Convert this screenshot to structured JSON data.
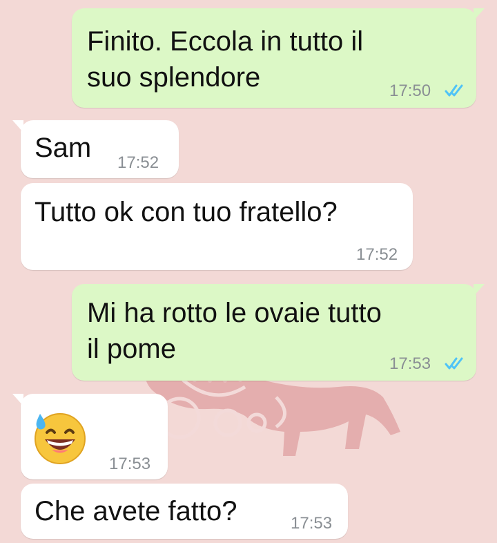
{
  "theme": {
    "outgoing_bubble": "#dcf8c6",
    "incoming_bubble": "#ffffff",
    "wallpaper": "#f3d9d6",
    "read_tick": "#4fc3f7"
  },
  "messages": [
    {
      "direction": "outgoing",
      "text": "Finito. Eccola in tutto il\nsuo splendore",
      "time": "17:50",
      "status": "read-double-check-icon"
    },
    {
      "direction": "incoming",
      "text": "Sam",
      "time": "17:52"
    },
    {
      "direction": "incoming",
      "text": "Tutto ok con tuo fratello?",
      "time": "17:52"
    },
    {
      "direction": "outgoing",
      "text": "Mi ha rotto le ovaie tutto\nil pome",
      "time": "17:53",
      "status": "read-double-check-icon"
    },
    {
      "direction": "incoming",
      "emoji": "grinning-face-with-sweat-emoji",
      "time": "17:53"
    },
    {
      "direction": "incoming",
      "text": "Che avete fatto?",
      "time": "17:53"
    }
  ]
}
